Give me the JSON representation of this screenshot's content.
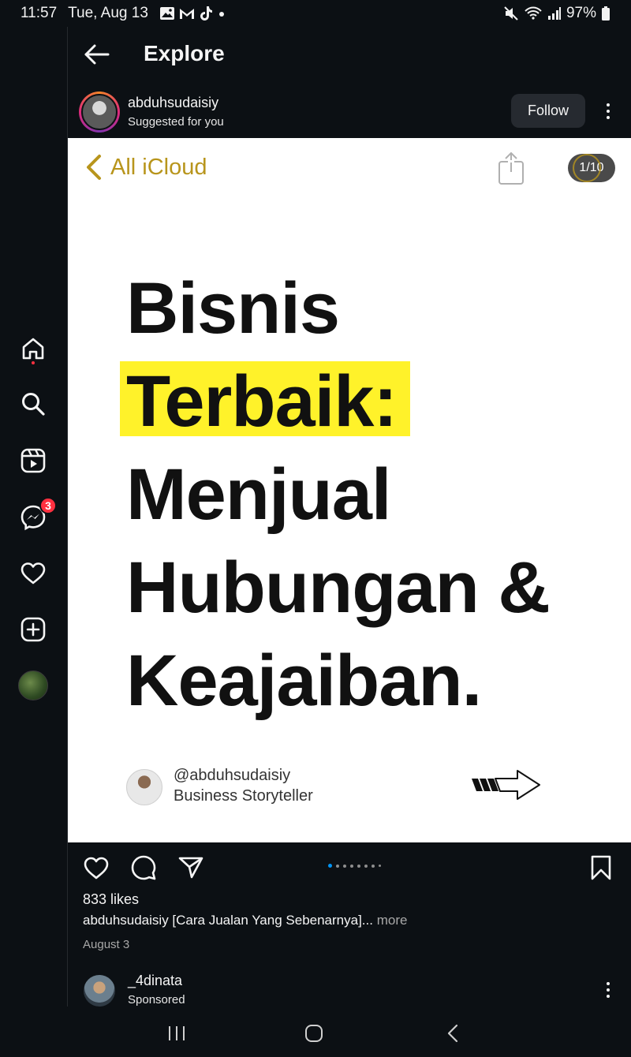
{
  "status_bar": {
    "time": "11:57",
    "date": "Tue, Aug 13",
    "battery": "97%"
  },
  "rail": {
    "messages_badge": "3"
  },
  "header": {
    "title": "Explore"
  },
  "post": {
    "username": "abduhsudaisiy",
    "subtitle": "Suggested for you",
    "follow_label": "Follow",
    "image": {
      "back_label": "All iCloud",
      "counter": "1/10",
      "line1": "Bisnis",
      "line2": "Terbaik:",
      "line3": "Menjual",
      "line4": "Hubungan &",
      "line5": "Keajaiban.",
      "author_handle": "@abduhsudaisiy",
      "author_role": "Business Storyteller",
      "highlight_color": "#fff22a"
    },
    "likes": "833 likes",
    "caption_user": "abduhsudaisiy",
    "caption_text": " [Cara Jualan Yang Sebenarnya]...",
    "caption_more": " more",
    "date": "August 3",
    "carousel": {
      "current": 1,
      "dots_shown": 8
    }
  },
  "next_post": {
    "username": "_4dinata",
    "subtitle": "Sponsored"
  },
  "colors": {
    "background": "#0c1014",
    "accent_blue": "#0095f6",
    "badge_red": "#ff3040",
    "icloud_gold": "#b8951c"
  }
}
